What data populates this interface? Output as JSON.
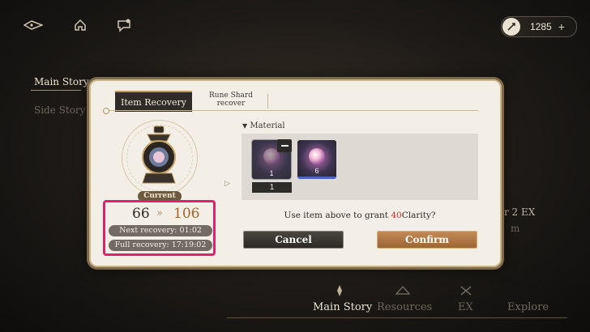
{
  "topbar": {
    "currency_value": "1285",
    "currency_plus": "+"
  },
  "background": {
    "left_nav": [
      "Main Story",
      "Side Story"
    ],
    "right_fragment_1": "r 2 EX",
    "right_fragment_2": "m",
    "bottom_nav": [
      "Main Story",
      "Resources",
      "EX",
      "Explore"
    ]
  },
  "dialog": {
    "tabs": [
      "Item Recovery",
      "Rune Shard recover"
    ],
    "current_label": "Current",
    "value_from": "66",
    "value_arrow": "»",
    "value_to": "106",
    "next_recovery": "Next recovery: 01:02",
    "full_recovery": "Full recovery: 17:19:02",
    "material_label": "Material",
    "items": [
      {
        "count": "1",
        "selected": "1"
      },
      {
        "count": "6"
      }
    ],
    "prompt_prefix": "Use item above to grant ",
    "prompt_amount": "40",
    "prompt_suffix": "Clarity?",
    "cancel_label": "Cancel",
    "confirm_label": "Confirm"
  },
  "colors": {
    "accent_highlight": "#e0226b",
    "confirm_button": "#b07845",
    "amount_red": "#c9352e",
    "target_value": "#a7642b"
  }
}
